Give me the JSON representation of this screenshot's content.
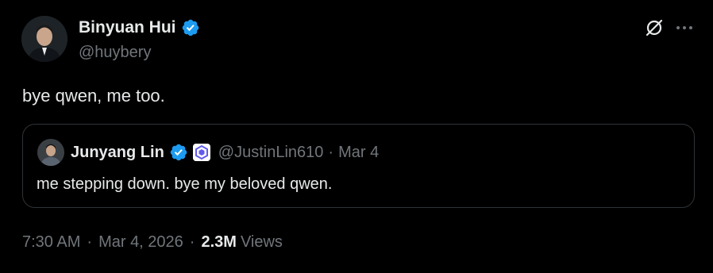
{
  "author": {
    "name": "Binyuan Hui",
    "handle": "@huybery",
    "verified": true,
    "avatar_icon": "avatar-photo-icon"
  },
  "tweet": {
    "text": "bye qwen, me too."
  },
  "quoted_tweet": {
    "author_name": "Junyang Lin",
    "handle": "@JustinLin610",
    "separator": "·",
    "date": "Mar 4",
    "text": "me stepping down. bye my beloved qwen.",
    "verified": true,
    "affiliate_badge_icon": "qwen-logo-icon"
  },
  "meta": {
    "time": "7:30 AM",
    "date": "Mar 4, 2026",
    "separator": "·",
    "views_count": "2.3M",
    "views_label": "Views"
  },
  "icons": {
    "grok": "grok-icon",
    "more": "more-icon"
  },
  "colors": {
    "background": "#000000",
    "text_primary": "#e7e9ea",
    "text_secondary": "#71767b",
    "verified_blue": "#1d9bf0",
    "border": "#2f3336"
  }
}
